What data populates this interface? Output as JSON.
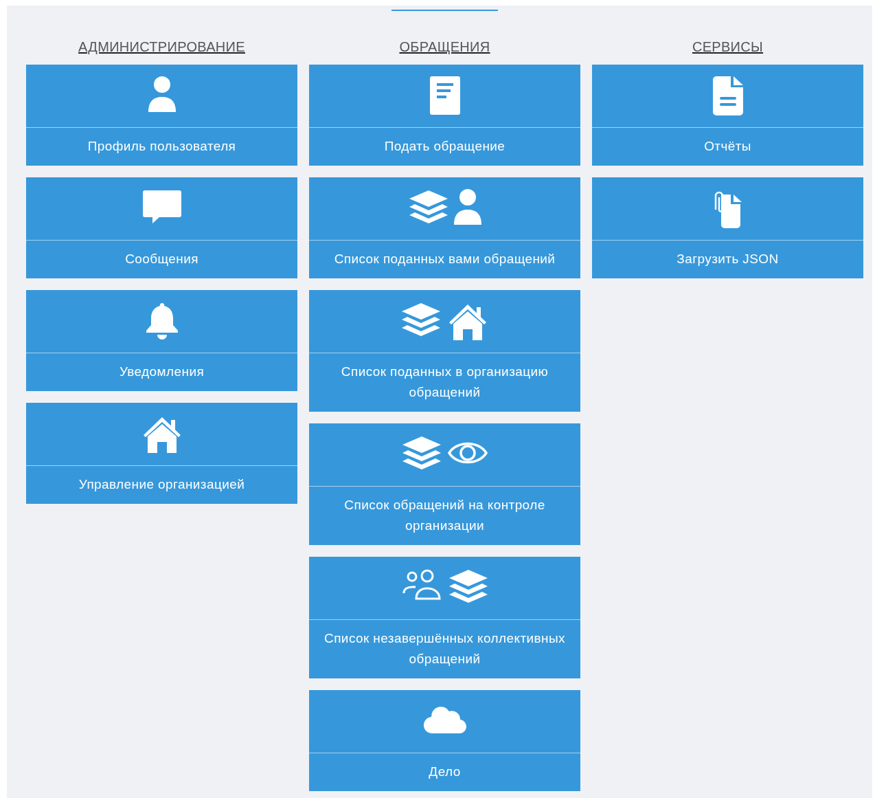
{
  "columns": [
    {
      "heading": "АДМИНИСТРИРОВАНИЕ",
      "selected": false,
      "tiles": [
        {
          "label": "Профиль пользователя",
          "icons": [
            {
              "kind": "user"
            }
          ]
        },
        {
          "label": "Сообщения",
          "icons": [
            {
              "kind": "chat"
            }
          ]
        },
        {
          "label": "Уведомления",
          "icons": [
            {
              "kind": "bell"
            }
          ]
        },
        {
          "label": "Управление организацией",
          "icons": [
            {
              "kind": "house"
            }
          ]
        }
      ]
    },
    {
      "heading": "ОБРАЩЕНИЯ",
      "selected": true,
      "tiles": [
        {
          "label": "Подать обращение",
          "icons": [
            {
              "kind": "document"
            }
          ]
        },
        {
          "label": "Список поданных вами обращений",
          "icons": [
            {
              "kind": "layers"
            },
            {
              "kind": "user"
            }
          ]
        },
        {
          "label": "Список поданных в организацию обращений",
          "icons": [
            {
              "kind": "layers"
            },
            {
              "kind": "house"
            }
          ]
        },
        {
          "label": "Список обращений на контроле организации",
          "icons": [
            {
              "kind": "layers"
            },
            {
              "kind": "eye"
            }
          ]
        },
        {
          "label": "Список незавершённых коллективных обращений",
          "icons": [
            {
              "kind": "users"
            },
            {
              "kind": "layers"
            }
          ]
        },
        {
          "label": "Дело",
          "icons": [
            {
              "kind": "cloud"
            }
          ]
        }
      ]
    },
    {
      "heading": "СЕРВИСЫ",
      "selected": false,
      "tiles": [
        {
          "label": "Отчёты",
          "icons": [
            {
              "kind": "file"
            }
          ]
        },
        {
          "label": "Загрузить JSON",
          "icons": [
            {
              "kind": "attachment"
            }
          ]
        }
      ]
    }
  ]
}
